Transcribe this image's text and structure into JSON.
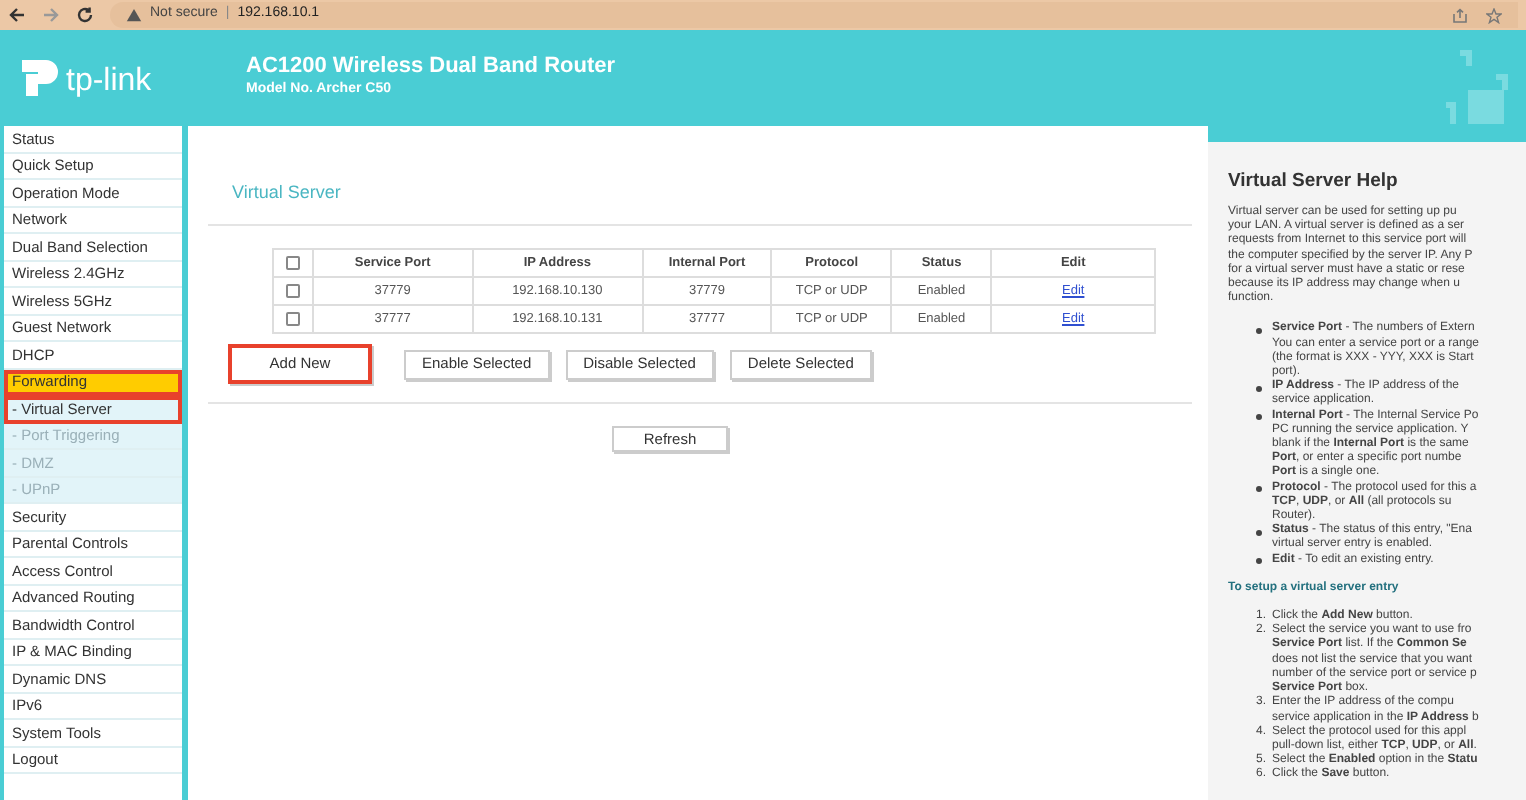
{
  "browser": {
    "security_label": "Not secure",
    "separator": "|",
    "url": "192.168.10.1"
  },
  "header": {
    "logo_text": "tp-link",
    "title": "AC1200 Wireless Dual Band Router",
    "model": "Model No. Archer C50"
  },
  "sidebar": {
    "items": [
      {
        "label": "Status",
        "selected": false
      },
      {
        "label": "Quick Setup",
        "selected": false
      },
      {
        "label": "Operation Mode",
        "selected": false
      },
      {
        "label": "Network",
        "selected": false
      },
      {
        "label": "Dual Band Selection",
        "selected": false
      },
      {
        "label": "Wireless 2.4GHz",
        "selected": false
      },
      {
        "label": "Wireless 5GHz",
        "selected": false
      },
      {
        "label": "Guest Network",
        "selected": false
      },
      {
        "label": "DHCP",
        "selected": false
      },
      {
        "label": "Forwarding",
        "selected": true,
        "expanded": true,
        "children": [
          {
            "label": "- Virtual Server",
            "selected": true
          },
          {
            "label": "- Port Triggering",
            "selected": false
          },
          {
            "label": "- DMZ",
            "selected": false
          },
          {
            "label": "- UPnP",
            "selected": false
          }
        ]
      },
      {
        "label": "Security",
        "selected": false
      },
      {
        "label": "Parental Controls",
        "selected": false
      },
      {
        "label": "Access Control",
        "selected": false
      },
      {
        "label": "Advanced Routing",
        "selected": false
      },
      {
        "label": "Bandwidth Control",
        "selected": false
      },
      {
        "label": "IP & MAC Binding",
        "selected": false
      },
      {
        "label": "Dynamic DNS",
        "selected": false
      },
      {
        "label": "IPv6",
        "selected": false
      },
      {
        "label": "System Tools",
        "selected": false
      },
      {
        "label": "Logout",
        "selected": false
      }
    ]
  },
  "main": {
    "title": "Virtual Server",
    "table": {
      "select_all_checked": false,
      "columns": [
        "Service Port",
        "IP Address",
        "Internal Port",
        "Protocol",
        "Status",
        "Edit"
      ],
      "rows": [
        {
          "checked": false,
          "cells": [
            "37779",
            "192.168.10.130",
            "37779",
            "TCP or UDP",
            "Enabled",
            "Edit"
          ]
        },
        {
          "checked": false,
          "cells": [
            "37777",
            "192.168.10.131",
            "37777",
            "TCP or UDP",
            "Enabled",
            "Edit"
          ]
        }
      ]
    },
    "buttons": [
      {
        "label": "Add New",
        "highlighted": true
      },
      {
        "label": "Enable Selected",
        "highlighted": false
      },
      {
        "label": "Disable Selected",
        "highlighted": false
      },
      {
        "label": "Delete Selected",
        "highlighted": false
      }
    ],
    "refresh_button": "Refresh"
  },
  "help": {
    "title": "Virtual Server Help",
    "intro": [
      "Virtual server can be used for setting up pu",
      "your LAN. A virtual server is defined as a ser",
      "requests from Internet to this service port will",
      "the computer specified by the server IP. Any P",
      "for a virtual server must have a static or rese",
      "because its IP address may change when u",
      "function."
    ],
    "bullets": [
      [
        "**Service Port** - The numbers of Extern",
        "You can enter a service port or a range",
        "(the format is XXX - YYY, XXX is Start",
        "port)."
      ],
      [
        "**IP Address** - The IP address of the",
        "service application."
      ],
      [
        "**Internal Port** - The Internal Service Po",
        "PC running the service application. Y",
        "blank if the **Internal Port** is the same",
        "**Port**, or enter a specific port numbe",
        "**Port** is a single one."
      ],
      [
        "**Protocol** - The protocol used for this a",
        "**TCP**, **UDP**, or **All** (all protocols su",
        "Router)."
      ],
      [
        "**Status** - The status of this entry, \"Ena",
        "virtual server entry is enabled."
      ],
      [
        "**Edit** - To edit an existing entry."
      ]
    ],
    "steps_title": "To setup a virtual server entry",
    "steps": [
      {
        "number": "1.",
        "lines": [
          "Click the **Add New** button."
        ]
      },
      {
        "number": "2.",
        "lines": [
          "Select the service you want to use fro",
          "**Service Port** list. If the **Common Se**",
          "does not list the service that you want",
          "number of the service port or service p",
          "**Service Port** box."
        ]
      },
      {
        "number": "3.",
        "lines": [
          "Enter the IP address of the compu",
          "service application in the **IP Address** b"
        ]
      },
      {
        "number": "4.",
        "lines": [
          "Select the protocol used for this appl",
          "pull-down list, either **TCP**, **UDP**, or **All**."
        ]
      },
      {
        "number": "5.",
        "lines": [
          "Select the **Enabled** option in the **Statu**"
        ]
      },
      {
        "number": "6.",
        "lines": [
          "Click the **Save** button."
        ]
      }
    ]
  }
}
